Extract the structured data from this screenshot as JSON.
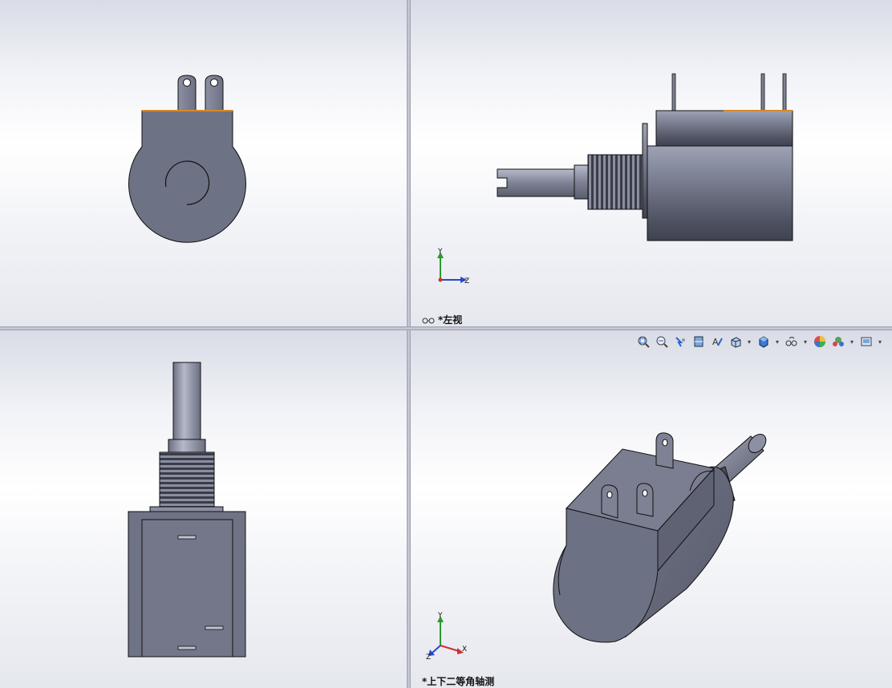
{
  "viewports": {
    "top_left": {
      "label": ""
    },
    "top_right": {
      "label": "*左视"
    },
    "bottom_left": {
      "label": ""
    },
    "bottom_right": {
      "label": "*上下二等角轴测"
    }
  },
  "triad": {
    "right_view": {
      "y": "Y",
      "z": "Z"
    },
    "iso_view": {
      "y": "Y",
      "x": "X",
      "z": "Z"
    }
  },
  "toolbar": {
    "icons": [
      "zoom-to-fit-icon",
      "zoom-to-area-icon",
      "previous-view-icon",
      "section-view-icon",
      "dynamic-annotation-icon",
      "view-orientation-icon",
      "display-style-icon",
      "hide-show-items-icon",
      "edit-appearance-icon",
      "apply-scene-icon",
      "view-settings-icon"
    ]
  },
  "colors": {
    "part_body": "#6f7386",
    "part_light": "#a9adc0",
    "part_dark": "#4a4d5c",
    "edge": "#111111",
    "accent_edge": "#d98a2b",
    "axis_x": "#d03030",
    "axis_y": "#2c9a2c",
    "axis_z": "#2848c8"
  }
}
